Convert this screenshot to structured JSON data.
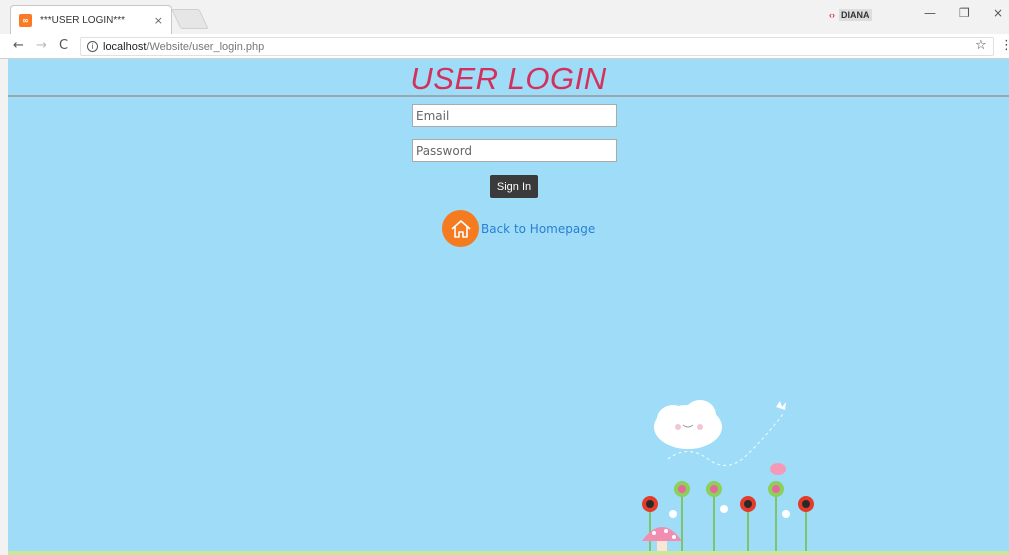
{
  "browser": {
    "tab_title": "***USER LOGIN***",
    "tab_close": "×",
    "favicon_text": "∞",
    "profile_name": "DIANA",
    "address_host": "localhost",
    "address_path": "/Website/user_login.php",
    "back_glyph": "←",
    "forward_glyph": "→",
    "reload_glyph": "C",
    "info_glyph": "i",
    "star_glyph": "☆",
    "menu_glyph": "⋮",
    "minimize_glyph": "—",
    "restore_glyph": "❐",
    "close_glyph": "×"
  },
  "page": {
    "title": "USER LOGIN",
    "email_placeholder": "Email",
    "password_placeholder": "Password",
    "signin_label": "Sign In",
    "back_link_label": "Back to Homepage"
  },
  "colors": {
    "background": "#9edcf8",
    "title": "#d3315c",
    "home_icon_bg": "#f47b20",
    "link": "#2a7fd4",
    "button_bg": "#3a3a3a"
  }
}
